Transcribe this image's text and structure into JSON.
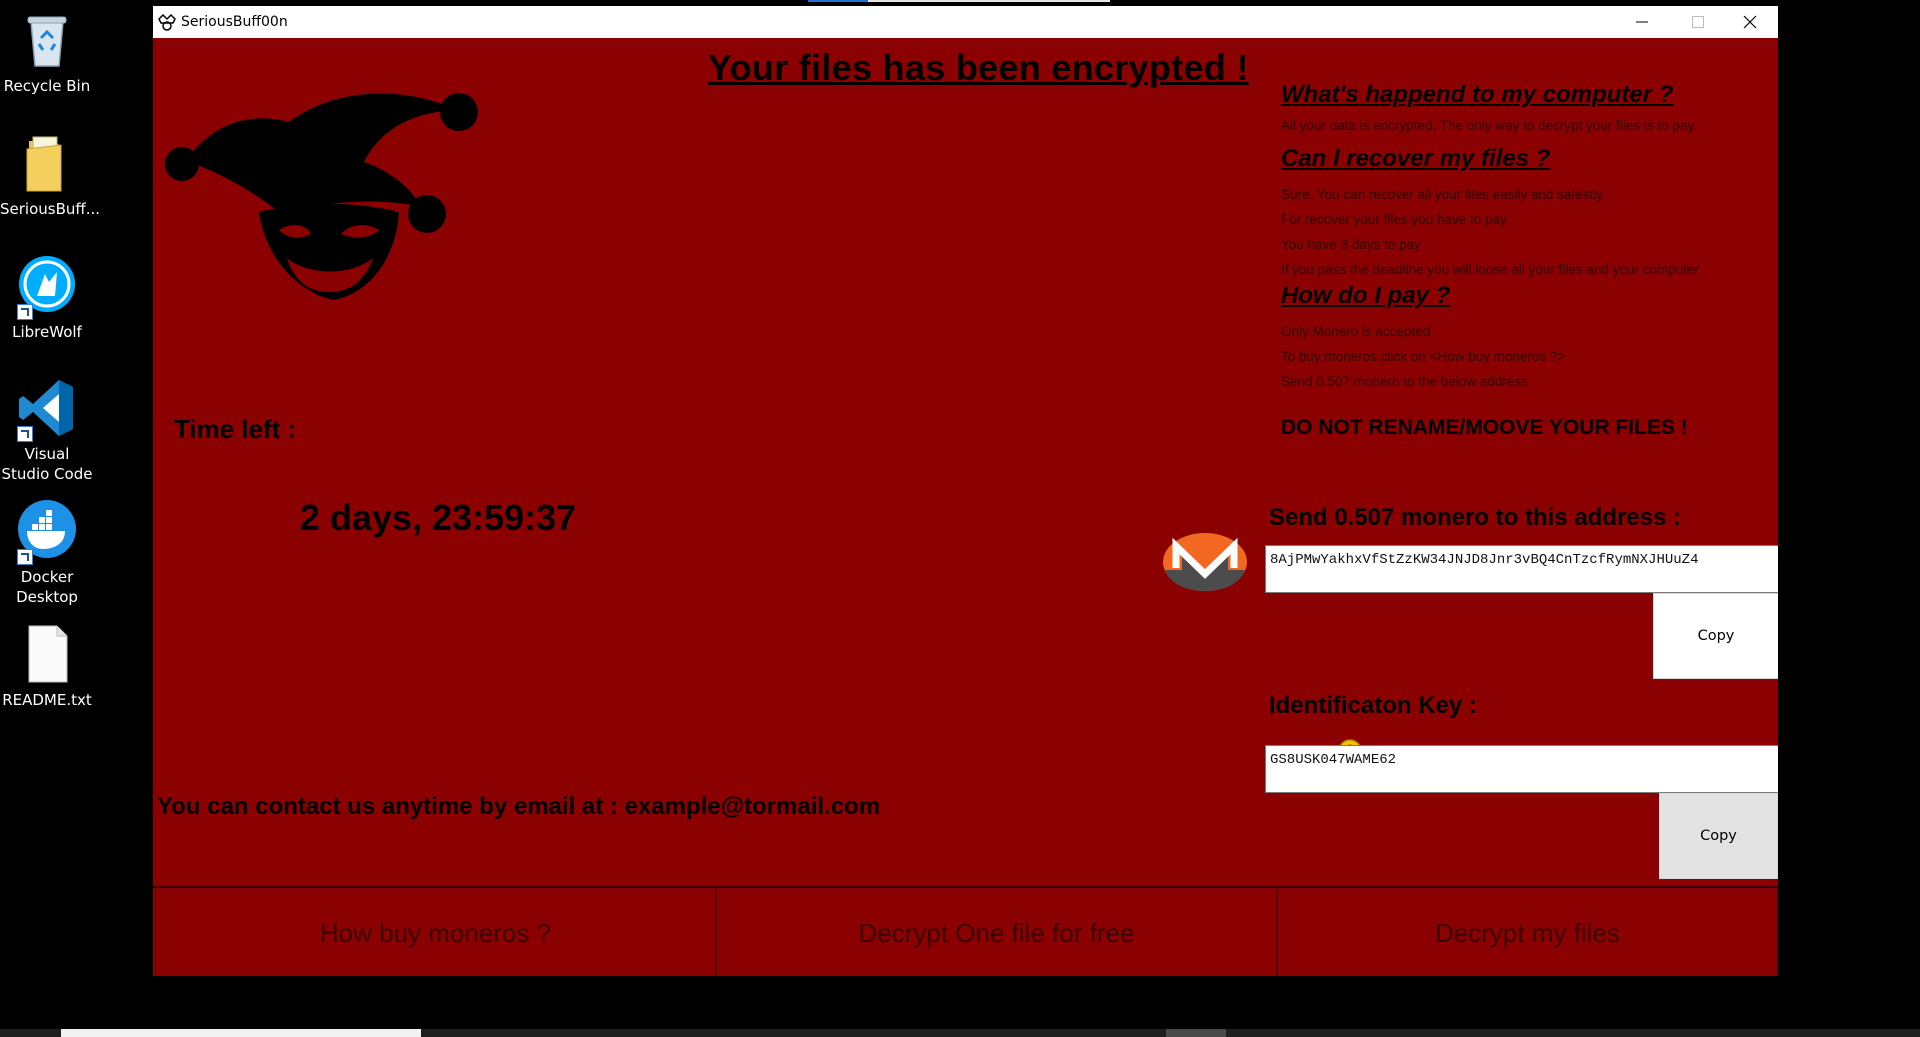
{
  "desktop": {
    "icons": [
      {
        "label": "Recycle Bin",
        "icon": "recycle-bin-icon"
      },
      {
        "label": "SeriousBuff...",
        "icon": "folder-icon"
      },
      {
        "label": "LibreWolf",
        "icon": "librewolf-icon"
      },
      {
        "label": "Visual Studio Code",
        "icon": "vscode-icon"
      },
      {
        "label": "Docker Desktop",
        "icon": "docker-icon"
      },
      {
        "label": "README.txt",
        "icon": "text-file-icon"
      }
    ]
  },
  "window": {
    "title": "SeriousBuff00n",
    "controls": [
      "minimize",
      "maximize",
      "close"
    ]
  },
  "ransom": {
    "headline": "Your files has been encrypted !",
    "time_label": "Time left :",
    "countdown": "2 days, 23:59:37",
    "contact": "You can contact us anytime by email at : example@tormail.com",
    "sections": [
      {
        "heading": "What's happend to my computer ?",
        "lines": [
          "All your data is encrypted. The only way to decrypt your files is to pay."
        ]
      },
      {
        "heading": "Can I recover my files ?",
        "lines": [
          "Sure. You can recover all your files easily and safestly",
          "For recover your files you have to pay",
          "You have 3 days to pay",
          "If you pass the deadline you will loose all your files and your computer"
        ]
      },
      {
        "heading": "How do I pay ?",
        "lines": [
          "Only Monero is accepted",
          "To buy moneros click on <How buy moneros ?>",
          "Send 0.507 monero to the below address"
        ]
      }
    ],
    "warning": "DO NOT RENAME/MOOVE YOUR FILES !",
    "send_label": "Send 0.507 monero to this address :",
    "address": "8AjPMwYakhxVfStZzKW34JNJD8Jnr3vBQ4CnTzcfRymNXJHUuZ4",
    "copy_label": "Copy",
    "id_label": "Identificaton Key :",
    "id_key": "GS8USK047WAME62",
    "buttons": {
      "buy": "How buy moneros ?",
      "decrypt_one": "Decrypt One file for free",
      "decrypt_all": "Decrypt my files"
    }
  },
  "colors": {
    "background": "#8b0000",
    "monero_orange": "#f26822",
    "monero_grey": "#4c4c4c",
    "key_yellow": "#f2c300"
  }
}
